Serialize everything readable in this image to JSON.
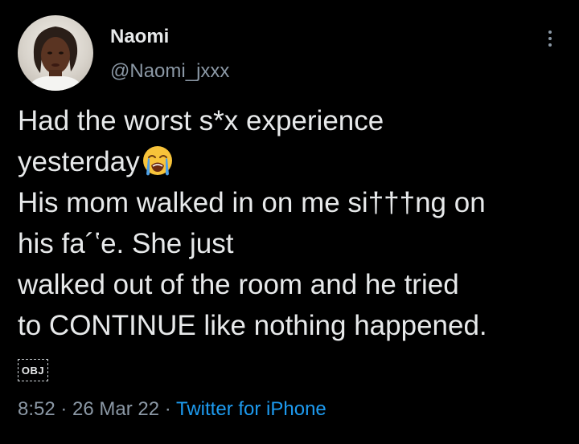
{
  "author": {
    "name": "Naomi",
    "handle": "@Naomi_jxxx"
  },
  "tweet": {
    "lines": [
      "Had the worst s*x experience",
      "yesterday",
      "His mom walked in on me si†††ng on",
      "his fa´ʽe. She just",
      "walked out of the room and he tried",
      "to CONTINUE like nothing happened."
    ],
    "emoji": "loudly-crying-face-emoji"
  },
  "obj_badge": "OBJ",
  "meta": {
    "time": "8:52",
    "sep1": " · ",
    "date": "26 Mar 22",
    "sep2": " · ",
    "source": "Twitter for iPhone"
  },
  "icons": {
    "more": "more-vertical-icon"
  },
  "colors": {
    "background": "#000000",
    "text": "#e7e9ea",
    "secondary": "#8b98a5",
    "link": "#1d9bf0"
  }
}
